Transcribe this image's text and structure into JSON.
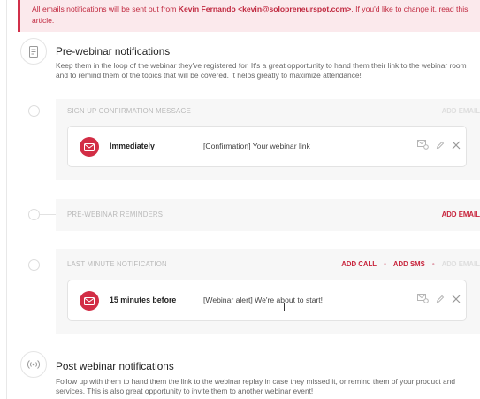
{
  "alert": {
    "before": "All emails notifications will be sent out from ",
    "sender": "Kevin Fernando <kevin@solopreneurspot.com>",
    "middle": ". If you'd like to change it, ",
    "link": "read this",
    "after": "article."
  },
  "pre_webinar": {
    "title": "Pre-webinar notifications",
    "desc_line1": "Keep them in the loop of the webinar they've registered for. It's a great opportunity to hand them their link to the webinar room",
    "desc_line2": "and to remind them of the topics that will be covered. It helps greatly to maximize attendance!",
    "panels": {
      "signup": {
        "label": "SIGN UP CONFIRMATION MESSAGE",
        "add_email": "ADD EMAIL",
        "card": {
          "when": "Immediately",
          "subject": "[Confirmation] Your webinar link"
        }
      },
      "reminders": {
        "label": "PRE-WEBINAR REMINDERS",
        "add_email": "ADD EMAIL"
      },
      "last_minute": {
        "label": "LAST MINUTE NOTIFICATION",
        "add_call": "ADD CALL",
        "add_sms": "ADD SMS",
        "add_email": "ADD EMAIL",
        "card": {
          "when": "15 minutes before",
          "subject": "[Webinar alert] We're about to start!"
        }
      }
    }
  },
  "post_webinar": {
    "title": "Post webinar notifications",
    "desc_line1": "Follow up with them to hand them the link to the webinar replay in case they missed it, or remind them of your product and",
    "desc_line2": "services. This is also great opportunity to invite them to another webinar event!"
  },
  "colors": {
    "accent": "#d22d45",
    "alert_bg": "#fbe9ec",
    "panel_bg": "#f7f7f7"
  },
  "icons": [
    "document-icon",
    "broadcast-icon",
    "envelope-icon",
    "preview-icon",
    "pencil-icon",
    "close-icon"
  ]
}
